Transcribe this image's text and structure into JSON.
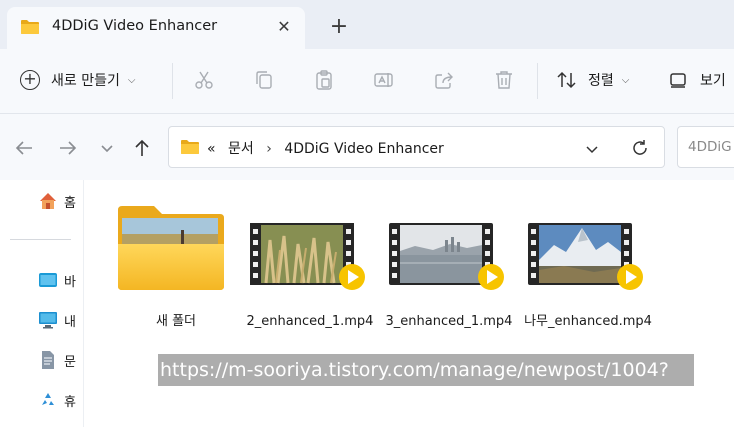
{
  "window": {
    "tab_title": "4DDiG Video Enhancer",
    "close_glyph": "✕",
    "new_tab_glyph": "+"
  },
  "toolbar": {
    "new_label": "새로 만들기",
    "new_icon": "plus-circle-icon",
    "sort_label": "정렬",
    "view_label": "보기",
    "icons": [
      "cut-icon",
      "copy-icon",
      "paste-icon",
      "rename-icon",
      "share-icon",
      "delete-icon"
    ]
  },
  "address": {
    "overflow": "«",
    "crumbs": [
      "문서",
      "4DDiG Video Enhancer"
    ],
    "separator": "›",
    "search_placeholder": "4DDiG"
  },
  "sidebar": {
    "items": [
      {
        "label": "홈",
        "icon": "home-icon"
      },
      {
        "label": "바",
        "icon": "desktop-icon"
      },
      {
        "label": "내",
        "icon": "this-pc-icon"
      },
      {
        "label": "문",
        "icon": "documents-icon"
      },
      {
        "label": "휴",
        "icon": "recycle-bin-icon"
      }
    ]
  },
  "files": [
    {
      "name": "새 폴더",
      "type": "folder"
    },
    {
      "name": "2_enhanced_1.mp4",
      "type": "video"
    },
    {
      "name": "3_enhanced_1.mp4",
      "type": "video"
    },
    {
      "name": "나무_enhanced.mp4",
      "type": "video"
    }
  ],
  "watermark": "https://m-sooriya.tistory.com/manage/newpost/1004?",
  "colors": {
    "folder": "#f9c93b",
    "play_badge": "#f7c400",
    "accent": "#005fb8"
  }
}
